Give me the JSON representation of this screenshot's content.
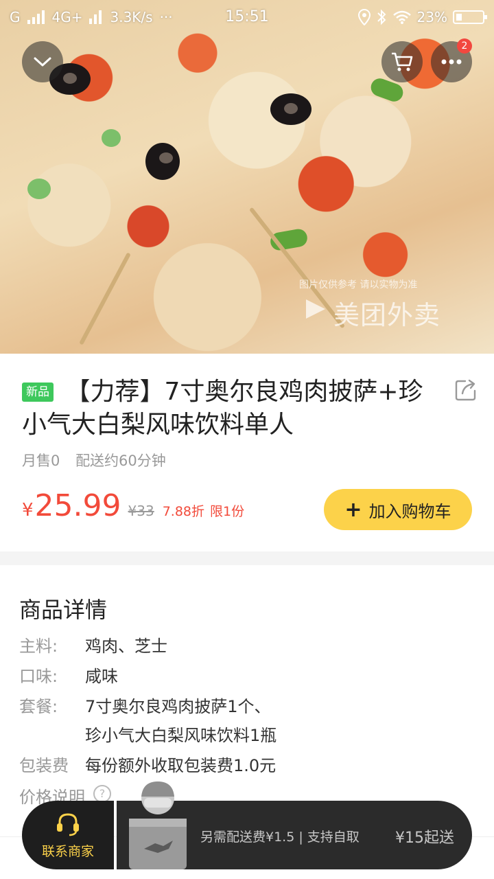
{
  "status_bar": {
    "network": "G",
    "network2": "4G+",
    "speed": "3.3K/s",
    "dots": "···",
    "time": "15:51",
    "battery": "23%"
  },
  "hero": {
    "watermark_note": "图片仅供参考 请以实物为准",
    "watermark_brand": "美团外卖",
    "cart_badge_count": "2"
  },
  "product": {
    "tag": "新品",
    "title": "【力荐】7寸奥尔良鸡肉披萨+珍小气大白梨风味饮料单人",
    "monthly_sales": "月售0",
    "delivery_time": "配送约60分钟",
    "price_symbol": "¥",
    "price": "25.99",
    "original_price": "¥33",
    "discount": "7.88折",
    "limit": "限1份",
    "add_to_cart_plus": "+",
    "add_to_cart_label": "加入购物车"
  },
  "details": {
    "title": "商品详情",
    "rows": [
      {
        "key": "主料:",
        "value": "鸡肉、芝士"
      },
      {
        "key": "口味:",
        "value": "咸味"
      },
      {
        "key": "套餐:",
        "value": "7寸奥尔良鸡肉披萨1个、"
      },
      {
        "key": "",
        "value": "珍小气大白梨风味饮料1瓶"
      },
      {
        "key": "包装费",
        "value": "每份额外收取包装费1.0元"
      }
    ],
    "price_note_label": "价格说明",
    "help_glyph": "?"
  },
  "bottom_bar": {
    "contact_label": "联系商家",
    "cart_note": "另需配送费¥1.5 | 支持自取",
    "min_order": "¥15起送"
  },
  "colors": {
    "accent_yellow": "#fcd24a",
    "price_red": "#f24a3a",
    "new_tag_green": "#3ec85c",
    "bar_dark": "#2b2b2b"
  },
  "icons": {
    "collapse": "chevron-down-icon",
    "cart": "cart-icon",
    "more": "more-icon",
    "share": "share-icon",
    "contact": "headset-icon",
    "help": "help-icon"
  }
}
